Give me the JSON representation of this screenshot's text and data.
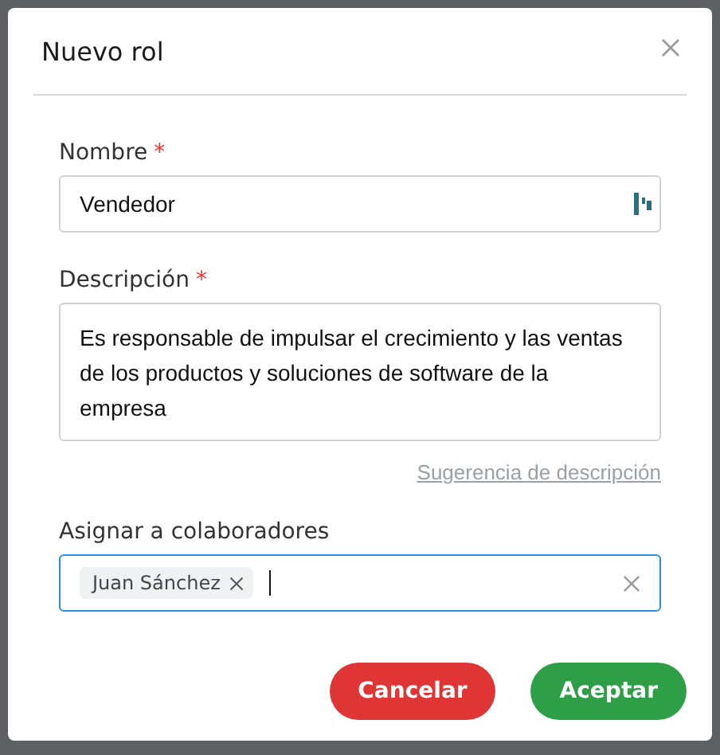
{
  "dialog": {
    "title": "Nuevo rol"
  },
  "fields": [
    {
      "kind": "text",
      "label": "Nombre",
      "required_mark": "*",
      "value": "Vendedor",
      "focused": false
    },
    {
      "kind": "textarea",
      "label": "Descripción",
      "required_mark": "*",
      "value": "Es responsable de impulsar el crecimiento y las ventas de los productos y soluciones de software de la empresa",
      "focused": false,
      "link": "Sugerencia de descripción"
    },
    {
      "kind": "tags",
      "label": "Asignar a colaboradores",
      "tags": [
        "Juan Sánchez"
      ],
      "focused": true
    }
  ],
  "buttons": [
    {
      "label": "Cancelar",
      "kind": "danger"
    },
    {
      "label": "Aceptar",
      "kind": "primary"
    }
  ]
}
